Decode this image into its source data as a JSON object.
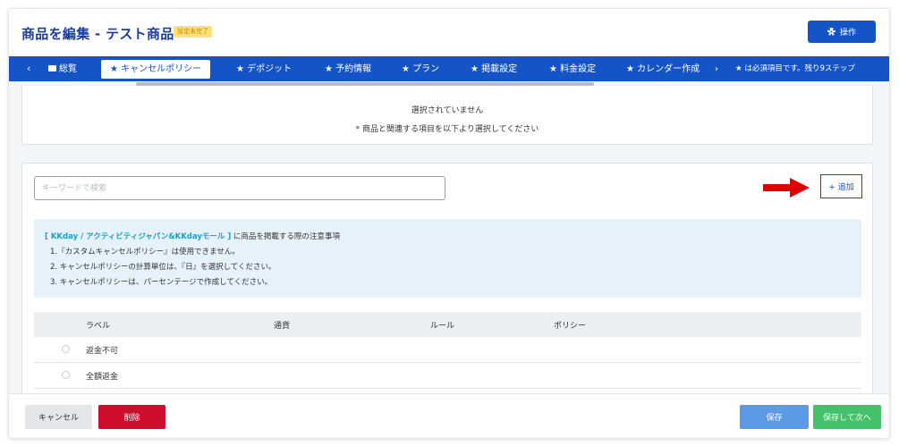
{
  "header": {
    "title": "商品を編集 - テスト商品",
    "status_badge": "設定未完了",
    "actions_label": "操作"
  },
  "tabs": {
    "prev_arrow": "‹",
    "items": [
      {
        "label": "総覧"
      },
      {
        "label": "★ キャンセルポリシー"
      },
      {
        "label": "★ デポジット"
      },
      {
        "label": "★ 予約情報"
      },
      {
        "label": "★ プラン"
      },
      {
        "label": "★ 掲載設定"
      },
      {
        "label": "★ 料金設定"
      },
      {
        "label": "★ カレンダー作成"
      }
    ],
    "next_arrow": "›",
    "required_note": "★ は必須項目です。残り9ステップ",
    "active_index": 1
  },
  "selected_panel": {
    "empty_text": "選択されていません",
    "hint_text": "* 商品と関連する項目を以下より選択してください"
  },
  "search": {
    "placeholder": "キーワードで検索",
    "value": ""
  },
  "add_button": "+ 追加",
  "notice": {
    "highlight": "[ KKday / アクティビティジャパン&KKdayモール ]",
    "heading_rest": " に商品を掲載する際の注意事項",
    "items": [
      "1.『カスタムキャンセルポリシー』は使用できません。",
      "2. キャンセルポリシーの計算単位は、『日』を選択してください。",
      "3. キャンセルポリシーは、パーセンテージで作成してください。"
    ]
  },
  "table": {
    "columns": [
      "ラベル",
      "通貨",
      "ルール",
      "ポリシー"
    ],
    "rows": [
      {
        "label": "返金不可"
      },
      {
        "label": "全額返金"
      }
    ]
  },
  "footer": {
    "cancel": "キャンセル",
    "delete": "削除",
    "save": "保存",
    "save_next": "保存して次へ"
  },
  "colors": {
    "brand_blue": "#1554c7",
    "title_blue": "#1c3c9c",
    "badge_yellow": "#ffe07a",
    "notice_bg": "#e6f1fa",
    "delete_red": "#cc0d2b",
    "save_blue": "#5b9be6",
    "save_next_green": "#43c16b",
    "arrow_red": "#e00000"
  },
  "icons": {
    "actions": "gear-icon",
    "overview_tab": "book-icon",
    "annotation": "red-arrow-icon"
  }
}
